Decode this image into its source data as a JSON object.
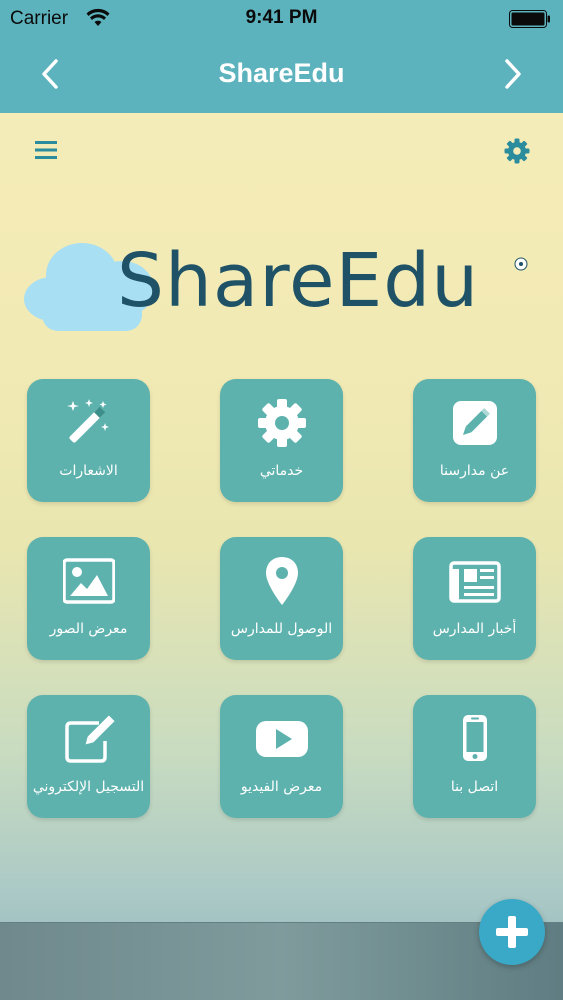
{
  "status": {
    "carrier": "Carrier",
    "time": "9:41 PM"
  },
  "nav": {
    "title": "ShareEdu"
  },
  "logo": {
    "text": "ShareEdu"
  },
  "tiles": [
    {
      "label": "عن مدارسنا",
      "icon": "edit-icon"
    },
    {
      "label": "خدماتي",
      "icon": "gear-icon"
    },
    {
      "label": "الاشعارات",
      "icon": "magic-wand-icon"
    },
    {
      "label": "أخبار المدارس",
      "icon": "newspaper-icon"
    },
    {
      "label": "الوصول للمدارس",
      "icon": "map-pin-icon"
    },
    {
      "label": "معرض الصور",
      "icon": "image-icon"
    },
    {
      "label": "اتصل بنا",
      "icon": "phone-icon"
    },
    {
      "label": "معرض الفيديو",
      "icon": "video-play-icon"
    },
    {
      "label": "التسجيل الإلكتروني",
      "icon": "pencil-square-icon"
    }
  ],
  "colors": {
    "nav_bar": "#5cb3bd",
    "tile": "#5db2ae",
    "fab": "#3aa9c7",
    "logo_text": "#1f5266"
  }
}
